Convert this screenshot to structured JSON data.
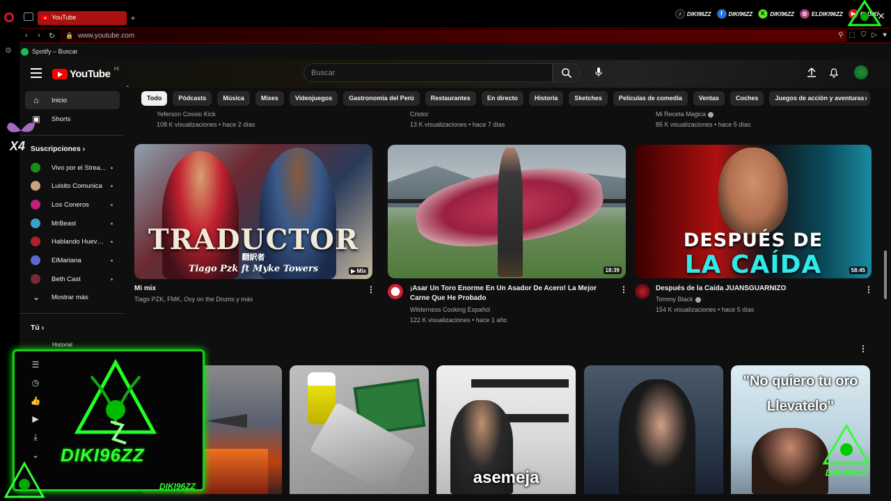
{
  "browser": {
    "tab_title": "YouTube",
    "url": "www.youtube.com",
    "bookmark": "Spotify – Buscar"
  },
  "socials": [
    {
      "icon": "tiktok-icon",
      "label": "DIKI96ZZ"
    },
    {
      "icon": "facebook-icon",
      "label": "DIKI96ZZ"
    },
    {
      "icon": "kick-icon",
      "label": "DIKI96ZZ"
    },
    {
      "icon": "instagram-icon",
      "label": "ELDIKI96ZZ"
    },
    {
      "icon": "youtube-icon",
      "label": "ELDIKI"
    }
  ],
  "header": {
    "logo": "YouTube",
    "country": "PE",
    "search_placeholder": "Buscar"
  },
  "sidebar": {
    "home": "Inicio",
    "shorts": "Shorts",
    "subscriptions": "Suscripciones",
    "channels": [
      {
        "name": "Vivo por el Strea...",
        "color": "#1a8c1a"
      },
      {
        "name": "Luisito Comunica",
        "color": "#c9a27a"
      },
      {
        "name": "Los Coneros",
        "color": "#c0207a"
      },
      {
        "name": "MrBeast",
        "color": "#3aa0c8"
      },
      {
        "name": "Hablando Huevadas",
        "color": "#b0202a"
      },
      {
        "name": "ElMariana",
        "color": "#5a6ad0"
      },
      {
        "name": "Beth Cast",
        "color": "#7a2a3a"
      }
    ],
    "show_more": "Mostrar más",
    "you": "Tú",
    "history": "Historial"
  },
  "chips": [
    "Todo",
    "Pódcasts",
    "Música",
    "Mixes",
    "Videojuegos",
    "Gastronomía del Perú",
    "Restaurantes",
    "En directo",
    "Historia",
    "Sketches",
    "Películas de comedia",
    "Ventas",
    "Coches",
    "Juegos de acción y aventuras"
  ],
  "previous_row": [
    {
      "channel": "Yeferson Cossio Kick",
      "meta": "108 K visualizaciones • hace 2 días"
    },
    {
      "channel": "Cristor",
      "meta": "13 K visualizaciones • hace 7 días"
    },
    {
      "channel": "Mi Receta Magica",
      "meta": "85 K visualizaciones • hace 5 días"
    }
  ],
  "videos": [
    {
      "thumb_text": "TRADUCTOR",
      "thumb_sub": "Tiago Pzk ft Myke Towers",
      "thumb_jp": "翻訳者",
      "badge": "Mix",
      "title": "Mi mix",
      "line2": "Tiago PZK, FMK, Ovy on the Drums y más"
    },
    {
      "duration": "18:39",
      "title_l1": "¡Asar Un Toro Enorme En Un Asador De Acero! La Mejor",
      "title_l2": "Carne Que He Probado",
      "channel": "Wilderness Cooking Español",
      "meta": "122 K visualizaciones • hace 1 año"
    },
    {
      "thumb_l1": "DESPUÉS DE",
      "thumb_l2": "LA CAÍDA",
      "duration": "58:45",
      "title": "Después de la Caída JUANSGUARNIZO",
      "channel": "Tommy Black",
      "meta": "154 K visualizaciones • hace 5 días"
    }
  ],
  "shorts": [
    {
      "caption": ""
    },
    {
      "caption": ""
    },
    {
      "caption": "asemeja"
    },
    {
      "caption": ""
    },
    {
      "caption_l1": "\"No quiero tu oro",
      "caption_l2": "Llevatelo\""
    }
  ],
  "overlay": {
    "name": "DIKI96ZZ",
    "footer": "DIKI96ZZ",
    "watermark": "DIKI96ZZ",
    "multiplier": "X4"
  },
  "colors": {
    "yt_red": "#ff0000",
    "overlay_green": "#1ec81e",
    "chip_selected": "#f1f1f1",
    "background": "#0f0f0f"
  }
}
